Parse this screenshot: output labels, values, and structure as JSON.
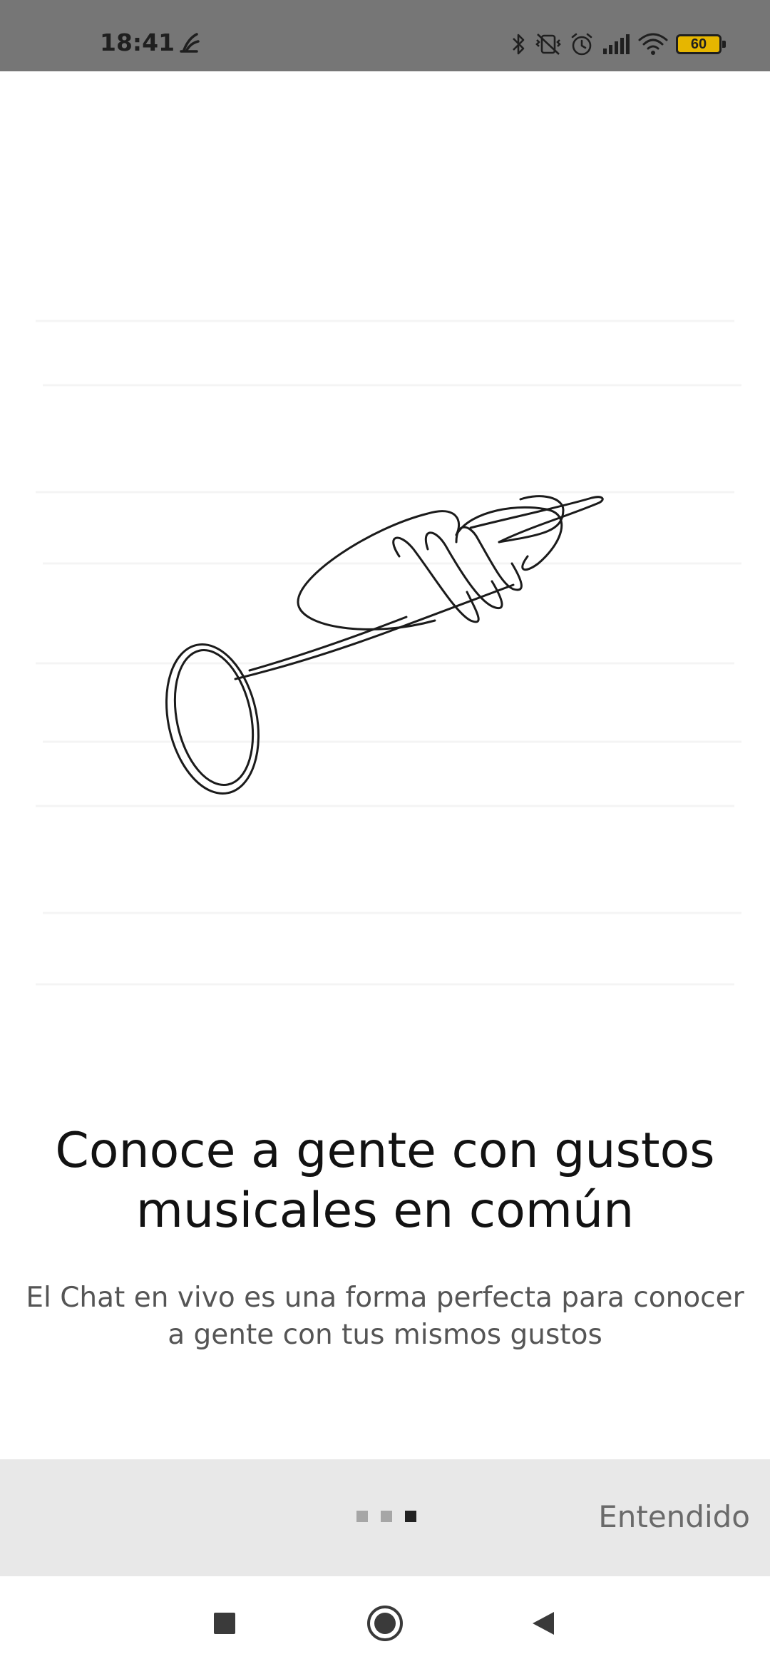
{
  "status_bar": {
    "time": "18:41",
    "battery_level": "60",
    "icons": [
      "bluetooth-icon",
      "vibrate-off-icon",
      "alarm-icon",
      "signal-icon",
      "wifi-icon",
      "battery-icon"
    ]
  },
  "onboarding": {
    "illustration": "trumpet-line-drawing",
    "title": "Conoce a gente con gustos musicales en común",
    "description": "El Chat en vivo es una forma perfecta para conocer a gente con tus mismos gustos",
    "page_indicator": {
      "total": 3,
      "current": 3
    },
    "dismiss_label": "Entendido"
  },
  "nav_bar": {
    "buttons": [
      "recents",
      "home",
      "back"
    ]
  },
  "colors": {
    "status_bar_bg": "#767676",
    "bottom_bar_bg": "#e8e8e8",
    "headline": "#121212",
    "body_text": "#555555",
    "battery_fill": "#e6b600"
  }
}
